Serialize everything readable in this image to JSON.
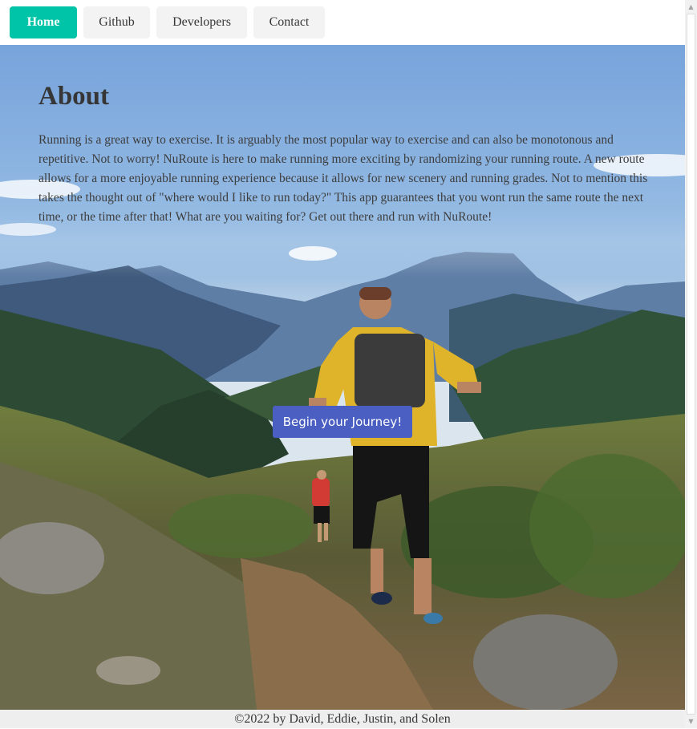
{
  "nav": {
    "items": [
      {
        "label": "Home",
        "active": true
      },
      {
        "label": "Github",
        "active": false
      },
      {
        "label": "Developers",
        "active": false
      },
      {
        "label": "Contact",
        "active": false
      }
    ]
  },
  "about": {
    "title": "About",
    "body": "Running is a great way to exercise. It is arguably the most popular way to exercise and can also be monotonous and repetitive. Not to worry! NuRoute is here to make running more exciting by randomizing your running route. A new route allows for a more enjoyable running experience because it allows for new scenery and running grades. Not to mention this takes the thought out of \"where would I like to run today?\" This app guarantees that you wont run the same route the next time, or the time after that! What are you waiting for? Get out there and run with NuRoute!"
  },
  "hero": {
    "cta_label": "Begin your Journey!",
    "image_icon": "mountain-trail-runners"
  },
  "footer": {
    "text": "©2022 by David, Eddie, Justin, and Solen"
  },
  "colors": {
    "accent_active": "#00c4a7",
    "cta": "#4a5fc1",
    "text": "#363636",
    "footer_bg": "#eeeeee"
  }
}
